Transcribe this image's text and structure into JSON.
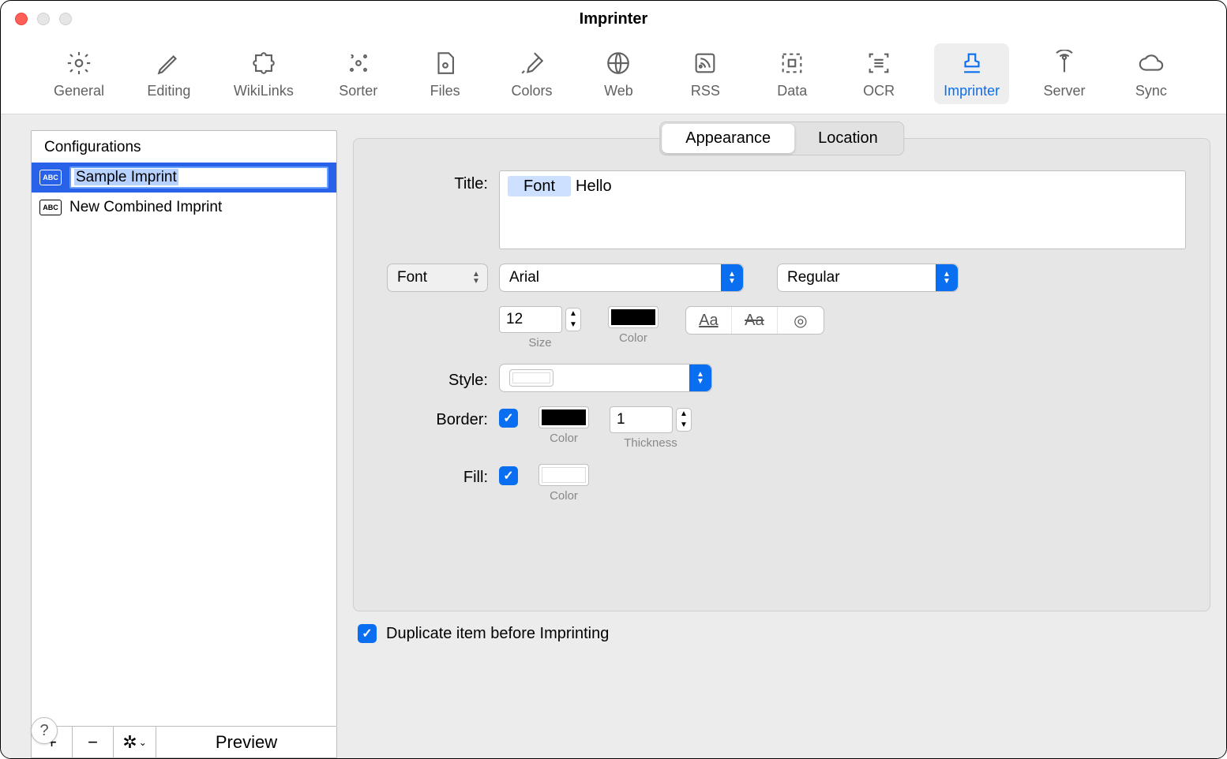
{
  "window": {
    "title": "Imprinter"
  },
  "toolbar": {
    "items": [
      {
        "label": "General"
      },
      {
        "label": "Editing"
      },
      {
        "label": "WikiLinks"
      },
      {
        "label": "Sorter"
      },
      {
        "label": "Files"
      },
      {
        "label": "Colors"
      },
      {
        "label": "Web"
      },
      {
        "label": "RSS"
      },
      {
        "label": "Data"
      },
      {
        "label": "OCR"
      },
      {
        "label": "Imprinter"
      },
      {
        "label": "Server"
      },
      {
        "label": "Sync"
      }
    ],
    "active_index": 10
  },
  "sidebar": {
    "header": "Configurations",
    "items": [
      {
        "name": "Sample Imprint",
        "editing": true
      },
      {
        "name": "New Combined Imprint",
        "editing": false
      }
    ],
    "selected_index": 0,
    "preview_label": "Preview"
  },
  "tabs": {
    "items": [
      "Appearance",
      "Location"
    ],
    "active_index": 0
  },
  "form": {
    "title_label": "Title:",
    "title_token": "Font",
    "title_text": "Hello",
    "font_popup_label": "Font",
    "font_family": "Arial",
    "font_style": "Regular",
    "size_value": "12",
    "size_label": "Size",
    "font_color_label": "Color",
    "style_label": "Style:",
    "style_value": "",
    "border_label": "Border:",
    "border_checked": true,
    "border_color_label": "Color",
    "thickness_value": "1",
    "thickness_label": "Thickness",
    "fill_label": "Fill:",
    "fill_checked": true,
    "fill_color_label": "Color",
    "text_style_samples": {
      "underline": "Aa",
      "strike": "Aa",
      "circle": "◎"
    }
  },
  "duplicate": {
    "checked": true,
    "label": "Duplicate item before Imprinting"
  },
  "help_label": "?"
}
